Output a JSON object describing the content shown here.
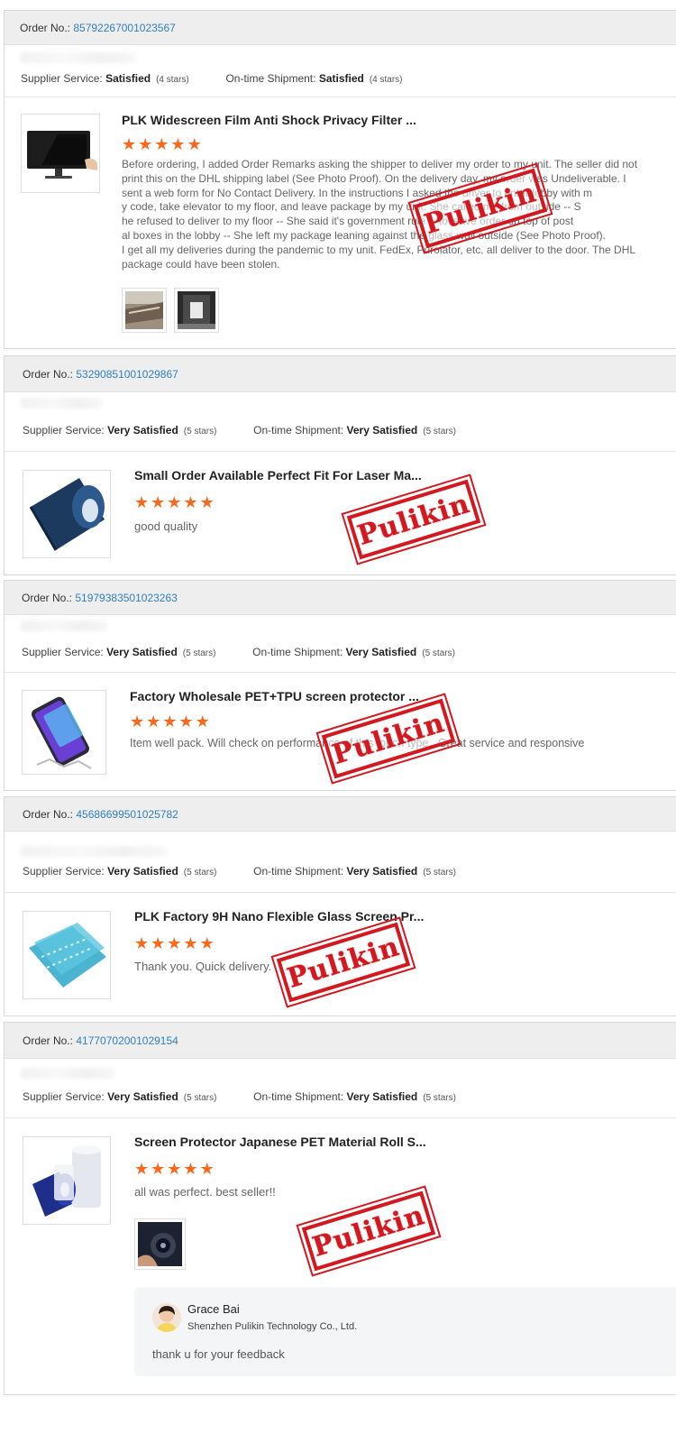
{
  "labels": {
    "order_no": "Order No.:",
    "supplier_service": "Supplier Service:",
    "ontime_shipment": "On-time Shipment:",
    "stamp": "Pulikin"
  },
  "colors": {
    "link": "#2f7fc1",
    "star": "#f7691c",
    "stamp": "#d3181f",
    "header_bg": "#eeeeee"
  },
  "orders": [
    {
      "order_number": "85792267001023567",
      "supplier_rating": "Satisfied",
      "supplier_stars": "(4 stars)",
      "shipment_rating": "Satisfied",
      "shipment_stars": "(4 stars)",
      "product_title": "PLK Widescreen Film Anti Shock Privacy Filter ...",
      "star_rating": 5,
      "review_lines": [
        "Before ordering, I added Order Remarks asking the shipper to deliver my order to my unit. The seller did not",
        "print this on the DHL shipping label (See Photo Proof). On the delivery day, my order was Undeliverable. I",
        "sent a web form for No Contact Delivery. In the instructions I asked the driver to enter lobby with m",
        "y code, take elevator to my floor, and leave package by my unit. She called me from outside -- S",
        "he refused to deliver to my floor -- She said it's government rule -- to leave order on top of post",
        "al boxes in the lobby -- She left my package leaning against the glass wall outside (See Photo Proof).",
        "I get all my deliveries during the pandemic to my unit. FedEx, Purolator, etc. all deliver to the door. The DHL",
        "package could have been stolen."
      ],
      "photo_count": 2
    },
    {
      "order_number": "53290851001029867",
      "supplier_rating": "Very Satisfied",
      "supplier_stars": "(5 stars)",
      "shipment_rating": "Very Satisfied",
      "shipment_stars": "(5 stars)",
      "product_title": "Small Order Available Perfect Fit For Laser Ma...",
      "star_rating": 5,
      "review_lines": [
        "good quality"
      ]
    },
    {
      "order_number": "51979383501023263",
      "supplier_rating": "Very Satisfied",
      "supplier_stars": "(5 stars)",
      "shipment_rating": "Very Satisfied",
      "shipment_stars": "(5 stars)",
      "product_title": "Factory Wholesale PET+TPU screen protector ...",
      "star_rating": 5,
      "review_lines": [
        "Item well pack. Will check on performance of this touch type.. Great service and responsive"
      ]
    },
    {
      "order_number": "45686699501025782",
      "supplier_rating": "Very Satisfied",
      "supplier_stars": "(5 stars)",
      "shipment_rating": "Very Satisfied",
      "shipment_stars": "(5 stars)",
      "product_title": "PLK Factory 9H Nano Flexible Glass Screen Pr...",
      "star_rating": 5,
      "review_lines": [
        "Thank you. Quick delivery."
      ]
    },
    {
      "order_number": "41770702001029154",
      "supplier_rating": "Very Satisfied",
      "supplier_stars": "(5 stars)",
      "shipment_rating": "Very Satisfied",
      "shipment_stars": "(5 stars)",
      "product_title": "Screen Protector Japanese PET Material Roll S...",
      "star_rating": 5,
      "review_lines": [
        "all was perfect. best seller!!"
      ],
      "photo_count": 1,
      "reply": {
        "name": "Grace Bai",
        "company": "Shenzhen Pulikin Technology Co., Ltd.",
        "message": "thank u for your feedback"
      }
    }
  ]
}
